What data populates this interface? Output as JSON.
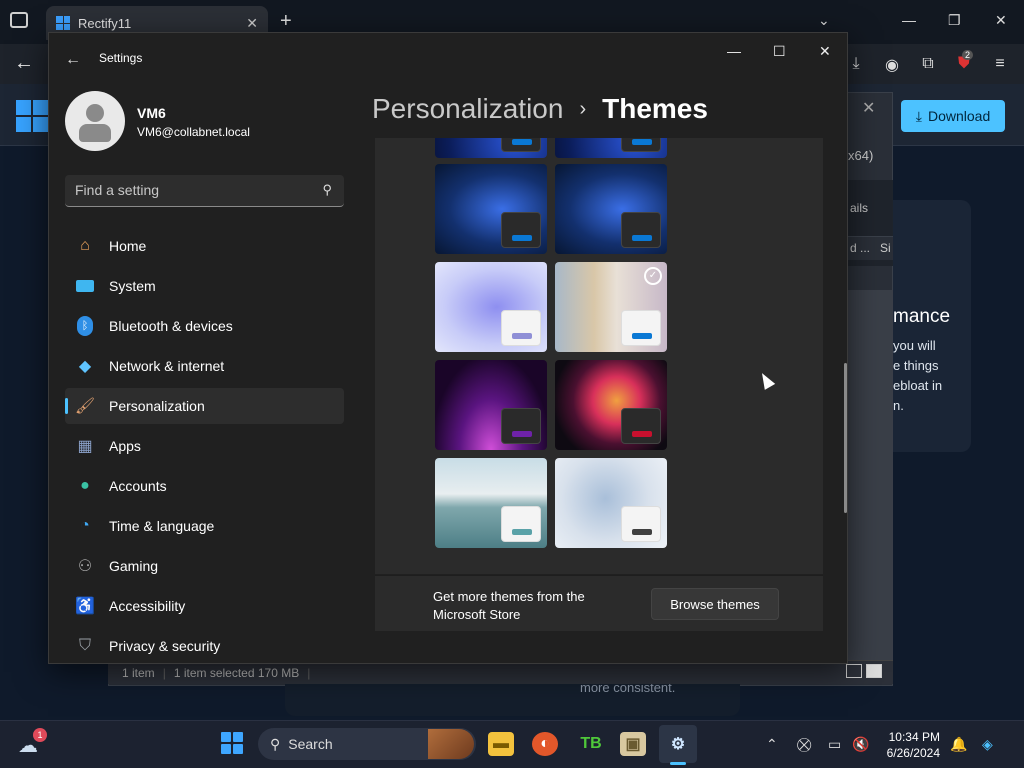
{
  "browser": {
    "tab_title": "Rectify11",
    "download_label": "Download",
    "extension_badge": "2"
  },
  "background_app": {
    "arch_text": "x64)",
    "details_text": "ails",
    "col_d": "d ...",
    "col_si": "Si",
    "heading_fragment": "mance",
    "para_lines": [
      "you will",
      "e things",
      "ebloat in",
      "n."
    ],
    "status_count": "1 item",
    "status_selected": "1 item selected  170 MB",
    "bottom_text": "more consistent."
  },
  "settings": {
    "window_title": "Settings",
    "user": {
      "name": "VM6",
      "email": "VM6@collabnet.local"
    },
    "search_placeholder": "Find a setting",
    "nav": [
      {
        "label": "Home",
        "icon": "home-icon",
        "color": "#e8a05a"
      },
      {
        "label": "System",
        "icon": "system-icon",
        "color": "#3fb6f0"
      },
      {
        "label": "Bluetooth & devices",
        "icon": "bluetooth-icon",
        "color": "#2f8fe6"
      },
      {
        "label": "Network & internet",
        "icon": "wifi-icon",
        "color": "#5fc4ff"
      },
      {
        "label": "Personalization",
        "icon": "brush-icon",
        "color": "#e0a070",
        "active": true
      },
      {
        "label": "Apps",
        "icon": "apps-icon",
        "color": "#8aa0c8"
      },
      {
        "label": "Accounts",
        "icon": "accounts-icon",
        "color": "#3ac2a4"
      },
      {
        "label": "Time & language",
        "icon": "time-language-icon",
        "color": "#3fa9f5"
      },
      {
        "label": "Gaming",
        "icon": "gamepad-icon",
        "color": "#a8a8a8"
      },
      {
        "label": "Accessibility",
        "icon": "accessibility-icon",
        "color": "#4aa6ff"
      },
      {
        "label": "Privacy & security",
        "icon": "shield-icon",
        "color": "#9aa0a6"
      }
    ],
    "breadcrumb_parent": "Personalization",
    "breadcrumb_current": "Themes",
    "more_themes_text": "Get more themes from the Microsoft Store",
    "browse_button": "Browse themes"
  },
  "themes": [
    {
      "name": "windows-dark-blue-top-1",
      "accent": "#0a78d4"
    },
    {
      "name": "windows-dark-blue-top-2",
      "accent": "#0a78d4"
    },
    {
      "name": "windows-dark-blue-1",
      "accent": "#0a78d4"
    },
    {
      "name": "windows-dark-blue-2",
      "accent": "#0a78d4"
    },
    {
      "name": "windows-light-lavender",
      "accent": "#8f8fd6"
    },
    {
      "name": "spotlight-selected",
      "accent": "#0a78d4",
      "selected": true
    },
    {
      "name": "glow-purple",
      "accent": "#6e22a8"
    },
    {
      "name": "captured-motion-flower",
      "accent": "#c8102e"
    },
    {
      "name": "sunrise-lake",
      "accent": "#5aa2a8"
    },
    {
      "name": "flow-light",
      "accent": "#404040"
    }
  ],
  "taskbar": {
    "search_label": "Search",
    "weather_badge": "1",
    "time": "10:34 PM",
    "date": "6/26/2024"
  }
}
